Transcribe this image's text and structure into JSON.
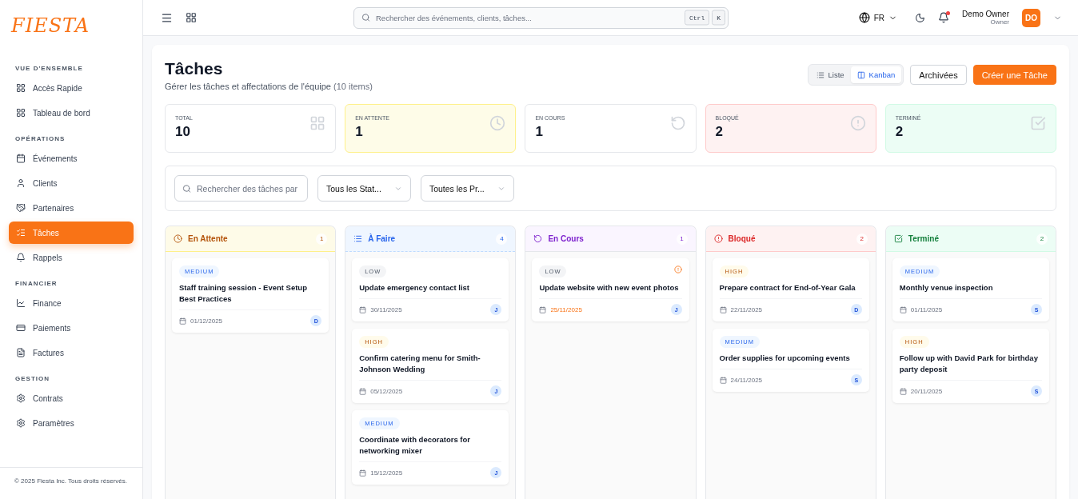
{
  "logo": "FIESTA",
  "sidebar": {
    "sections": [
      {
        "title": "VUE D'ENSEMBLE",
        "items": [
          {
            "label": "Accès Rapide",
            "selected": false
          },
          {
            "label": "Tableau de bord",
            "selected": false
          }
        ]
      },
      {
        "title": "OPÉRATIONS",
        "items": [
          {
            "label": "Événements",
            "selected": false
          },
          {
            "label": "Clients",
            "selected": false
          },
          {
            "label": "Partenaires",
            "selected": false
          },
          {
            "label": "Tâches",
            "selected": true
          },
          {
            "label": "Rappels",
            "selected": false
          }
        ]
      },
      {
        "title": "FINANCIER",
        "items": [
          {
            "label": "Finance",
            "selected": false
          },
          {
            "label": "Paiements",
            "selected": false
          },
          {
            "label": "Factures",
            "selected": false
          }
        ]
      },
      {
        "title": "GESTION",
        "items": [
          {
            "label": "Contrats",
            "selected": false
          },
          {
            "label": "Paramètres",
            "selected": false
          }
        ]
      }
    ],
    "footer": "© 2025 Fiesta Inc. Tous droits réservés."
  },
  "topbar": {
    "search": {
      "placeholder": "Rechercher des événements, clients, tâches..."
    },
    "shortcut": [
      "Ctrl",
      "K"
    ],
    "language": "FR",
    "notification": true,
    "user": {
      "name": "Demo Owner",
      "role": "Owner",
      "initials": "DO"
    }
  },
  "page": {
    "title": "Tâches",
    "subtitle": "Gérer les tâches et affectations de l'équipe",
    "count": "(10 items)",
    "views": [
      {
        "label": "Liste",
        "selected": false
      },
      {
        "label": "Kanban",
        "selected": true
      }
    ],
    "buttons": [
      {
        "label": "Archivées",
        "kind": "outline"
      },
      {
        "label": "Créer une Tâche",
        "kind": "primary"
      }
    ]
  },
  "stats": [
    {
      "label": "TOTAL",
      "value": "10",
      "kind": "total"
    },
    {
      "label": "EN ATTENTE",
      "value": "1",
      "kind": "pending"
    },
    {
      "label": "EN COURS",
      "value": "1",
      "kind": "progress"
    },
    {
      "label": "BLOQUÉ",
      "value": "2",
      "kind": "blocked"
    },
    {
      "label": "TERMINÉ",
      "value": "2",
      "kind": "done"
    }
  ],
  "filters": {
    "search": {
      "placeholder": "Rechercher des tâches par"
    },
    "selects": [
      "Tous les Stat...",
      "Toutes les Pr..."
    ]
  },
  "columns": [
    {
      "title": "En Attente",
      "count": "1",
      "kind": "pending",
      "cards": [
        {
          "priority": "MEDIUM",
          "kind": "medium",
          "title": "Staff training session - Event Setup Best Practices",
          "date": "01/12/2025",
          "overdue": false,
          "alert": false,
          "assignee": "D"
        }
      ]
    },
    {
      "title": "À Faire",
      "count": "4",
      "kind": "todo",
      "cards": [
        {
          "priority": "LOW",
          "kind": "low",
          "title": "Update emergency contact list",
          "date": "30/11/2025",
          "overdue": false,
          "alert": false,
          "assignee": "J"
        },
        {
          "priority": "HIGH",
          "kind": "high",
          "title": "Confirm catering menu for Smith-Johnson Wedding",
          "date": "05/12/2025",
          "overdue": false,
          "alert": false,
          "assignee": "J"
        },
        {
          "priority": "MEDIUM",
          "kind": "medium",
          "title": "Coordinate with decorators for networking mixer",
          "date": "15/12/2025",
          "overdue": false,
          "alert": false,
          "assignee": "J"
        }
      ]
    },
    {
      "title": "En Cours",
      "count": "1",
      "kind": "progress",
      "cards": [
        {
          "priority": "LOW",
          "kind": "low",
          "title": "Update website with new event photos",
          "date": "25/11/2025",
          "overdue": true,
          "alert": true,
          "assignee": "J"
        }
      ]
    },
    {
      "title": "Bloqué",
      "count": "2",
      "kind": "blocked",
      "cards": [
        {
          "priority": "HIGH",
          "kind": "high",
          "title": "Prepare contract for End-of-Year Gala",
          "date": "22/11/2025",
          "overdue": false,
          "alert": false,
          "assignee": "D"
        },
        {
          "priority": "MEDIUM",
          "kind": "medium",
          "title": "Order supplies for upcoming events",
          "date": "24/11/2025",
          "overdue": false,
          "alert": false,
          "assignee": "S"
        }
      ]
    },
    {
      "title": "Terminé",
      "count": "2",
      "kind": "done",
      "cards": [
        {
          "priority": "MEDIUM",
          "kind": "medium",
          "title": "Monthly venue inspection",
          "date": "01/11/2025",
          "overdue": false,
          "alert": false,
          "assignee": "S"
        },
        {
          "priority": "HIGH",
          "kind": "high",
          "title": "Follow up with David Park for birthday party deposit",
          "date": "20/11/2025",
          "overdue": false,
          "alert": false,
          "assignee": "S"
        }
      ]
    }
  ]
}
